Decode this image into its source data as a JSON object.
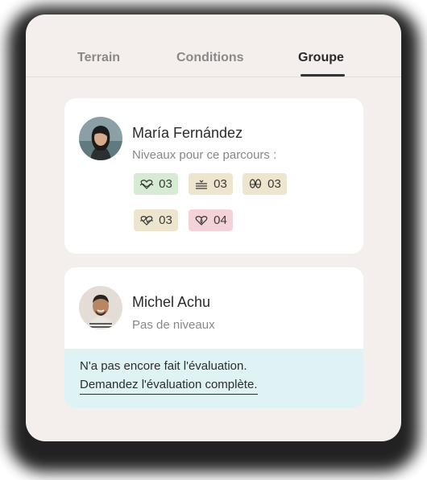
{
  "tabs": [
    {
      "label": "Terrain",
      "active": false
    },
    {
      "label": "Conditions",
      "active": false
    },
    {
      "label": "Groupe",
      "active": true
    }
  ],
  "members": [
    {
      "name": "María Fernández",
      "subtitle": "Niveaux pour ce parcours :",
      "levels": [
        {
          "icon": "heart-waves-icon",
          "value": "03",
          "color": "#d7ead3"
        },
        {
          "icon": "water-lines-icon",
          "value": "03",
          "color": "#ede5cd"
        },
        {
          "icon": "footprints-icon",
          "value": "03",
          "color": "#ede5cd"
        },
        {
          "icon": "heart-pulse-icon",
          "value": "03",
          "color": "#ede5cd"
        },
        {
          "icon": "heart-drop-icon",
          "value": "04",
          "color": "#f3d3d7"
        }
      ]
    },
    {
      "name": "Michel Achu",
      "subtitle": "Pas de niveaux",
      "notice": "N'a pas encore fait l'évaluation.",
      "link": "Demandez l'évaluation complète."
    }
  ]
}
